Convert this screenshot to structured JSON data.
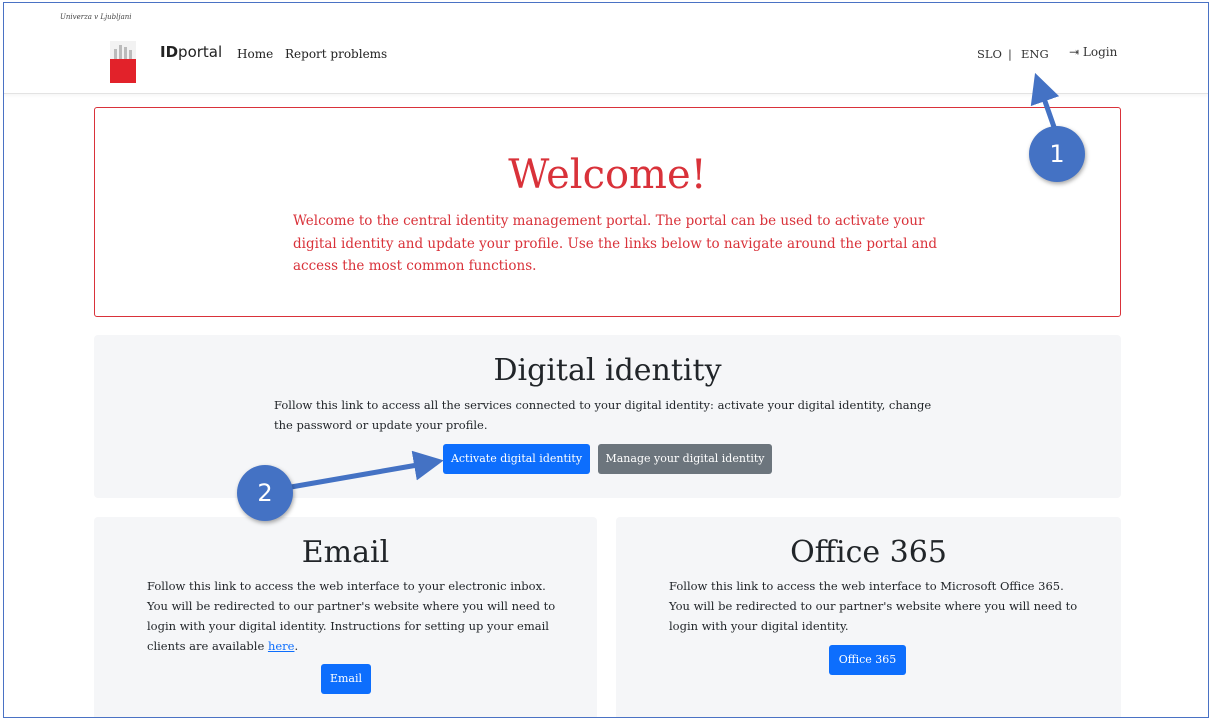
{
  "header": {
    "university": "Univerza v Ljubljani",
    "brand_bold": "ID",
    "brand_rest": "portal",
    "nav": [
      "Home",
      "Report problems"
    ],
    "lang_slo": "SLO",
    "lang_sep": "|",
    "lang_eng": "ENG",
    "login_icon": "login-arrow-icon",
    "login_label": "Login"
  },
  "welcome": {
    "title": "Welcome!",
    "text": "Welcome to the central identity management portal. The portal can be used to activate your digital identity and update your profile. Use the links below to navigate around the portal and access the most common functions."
  },
  "digital_identity": {
    "title": "Digital identity",
    "text": "Follow this link to access all the services connected to your digital identity: activate your digital identity, change the password or update your profile.",
    "activate_button": "Activate digital identity",
    "manage_button": "Manage your digital identity"
  },
  "email": {
    "title": "Email",
    "text": "Follow this link to access the web interface to your electronic inbox. You will be redirected to our partner's website where you will need to login with your digital identity. Instructions for setting up your email clients are available",
    "link_text": "here",
    "after_link": ".",
    "button": "Email"
  },
  "office": {
    "title": "Office 365",
    "text": "Follow this link to access the web interface to Microsoft Office 365. You will be redirected to our partner's website where you will need to login with your digital identity.",
    "button": "Office 365"
  },
  "callouts": [
    "1",
    "2"
  ],
  "colors": {
    "accent_red": "#d9323a",
    "primary_blue": "#0d6efd",
    "secondary_gray": "#6c757d",
    "callout_blue": "#4472c4"
  }
}
